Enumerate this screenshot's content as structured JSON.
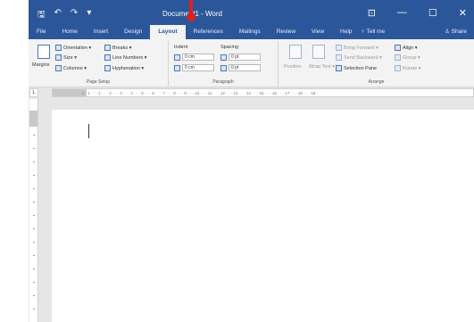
{
  "qat": {
    "save": "🖫",
    "undo": "↶",
    "redo": "↷",
    "more": "▾"
  },
  "title": "Document1 - Word",
  "window_controls": {
    "ribbon_options": "⊡",
    "minimize": "—",
    "maximize": "☐",
    "close": "✕"
  },
  "tabs": [
    "File",
    "Home",
    "Insert",
    "Design",
    "Layout",
    "References",
    "Mailings",
    "Review",
    "View",
    "Help"
  ],
  "active_tab": "Layout",
  "tell_me": "Tell me",
  "share": "Share",
  "page_setup": {
    "margins": "Margins",
    "orientation": "Orientation ▾",
    "size": "Size ▾",
    "columns": "Columns ▾",
    "breaks": "Breaks ▾",
    "line_numbers": "Line Numbers ▾",
    "hyphenation": "Hyphenation ▾",
    "label": "Page Setup"
  },
  "paragraph": {
    "indent": "Indent",
    "spacing": "Spacing",
    "left_value": "0 cm",
    "right_value": "0 cm",
    "before_value": "0 pt",
    "after_value": "0 pt",
    "label": "Paragraph"
  },
  "arrange": {
    "position": "Position",
    "wrap_text": "Wrap Text ▾",
    "bring_forward": "Bring Forward ▾",
    "send_backward": "Send Backward ▾",
    "selection_pane": "Selection Pane",
    "align": "Align ▾",
    "group": "Group ▾",
    "rotate": "Rotate ▾",
    "label": "Arrange"
  },
  "ruler_text": "· 2 · 1 · · · 1 · · · 2 · · · 3 · · · 4 · · · 5 · · · 6 · · · 7 · · · 8 · · · 9 · · · 10 · · · 11 · · · 12 · · · 13 · · · 14 · · · 15 · · · 16 · · · 17 · · · 18 · · · 19 ·",
  "ruler_corner": "L",
  "accent_color": "#2b579a",
  "highlight_color": "#e0201c"
}
